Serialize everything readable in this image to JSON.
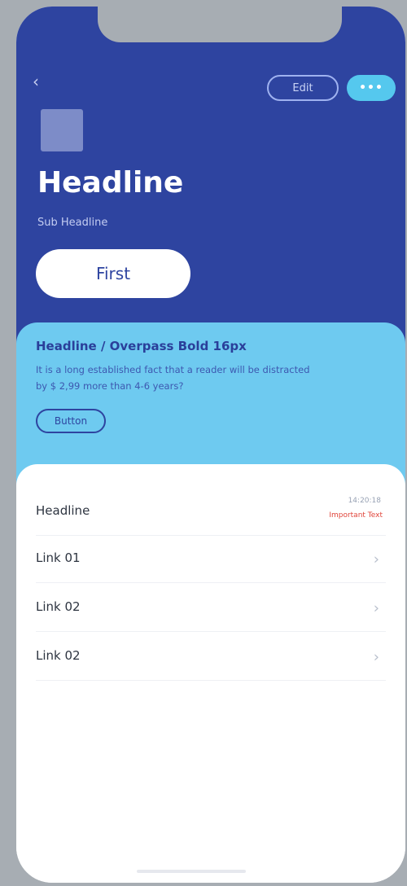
{
  "header": {
    "back_icon": "chevron-left-icon",
    "edit_label": "Edit",
    "more_label": "•••",
    "headline": "Headline",
    "subheadline": "Sub Headline",
    "first_label": "First"
  },
  "banner": {
    "title": "Headline / Overpass Bold 16px",
    "body": "It is a long established fact that a reader will be distracted by $ 2,99 more than 4-6 years?",
    "button_label": "Button"
  },
  "list": {
    "headline_row": {
      "label": "Headline",
      "time": "14:20:18",
      "tag": "Important Text"
    },
    "links": [
      {
        "label": "Link 01"
      },
      {
        "label": "Link 02"
      },
      {
        "label": "Link 02"
      }
    ],
    "chevron": "›"
  },
  "colors": {
    "header_bg": "#2e44a0",
    "banner_bg": "#6ecaf0",
    "accent": "#55c8ee",
    "alert": "#e0443a"
  }
}
